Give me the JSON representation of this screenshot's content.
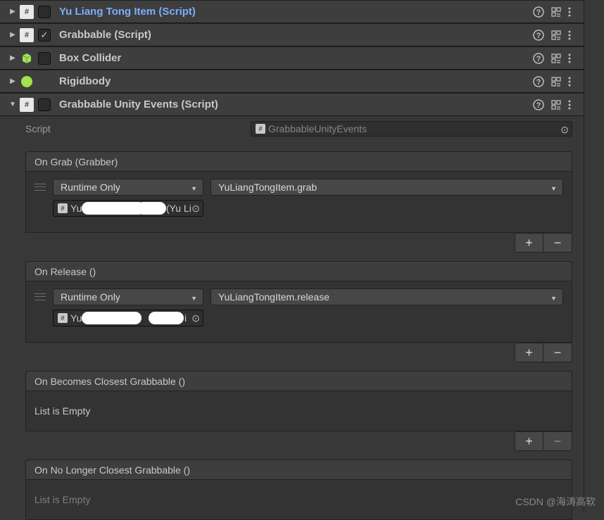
{
  "components": {
    "yuLiangTongItem": {
      "title": "Yu Liang Tong Item (Script)"
    },
    "grabbable": {
      "title": "Grabbable (Script)",
      "checked": "✓"
    },
    "boxCollider": {
      "title": "Box Collider"
    },
    "rigidbody": {
      "title": "Rigidbody"
    },
    "grabbableUnityEvents": {
      "title": "Grabbable Unity Events (Script)",
      "scriptLabel": "Script",
      "scriptValue": "GrabbableUnityEvents",
      "events": {
        "onGrab": {
          "header": "On Grab (Grabber)",
          "callState": "Runtime Only",
          "function": "YuLiangTongItem.grab",
          "targetPrefix": "Yu",
          "targetSuffix": "(Yu Li"
        },
        "onRelease": {
          "header": "On Release ()",
          "callState": "Runtime Only",
          "function": "YuLiangTongItem.release",
          "targetPrefix": "Yu",
          "targetSuffix": "i"
        },
        "onBecomesClosest": {
          "header": "On Becomes Closest Grabbable ()",
          "emptyText": "List is Empty"
        },
        "onNoLongerClosest": {
          "header": "On No Longer Closest Grabbable ()",
          "emptyText": "List is Empty"
        }
      }
    }
  },
  "icons": {
    "help": "?",
    "scriptHash": "#"
  },
  "watermark": "CSDN @海涛高软"
}
